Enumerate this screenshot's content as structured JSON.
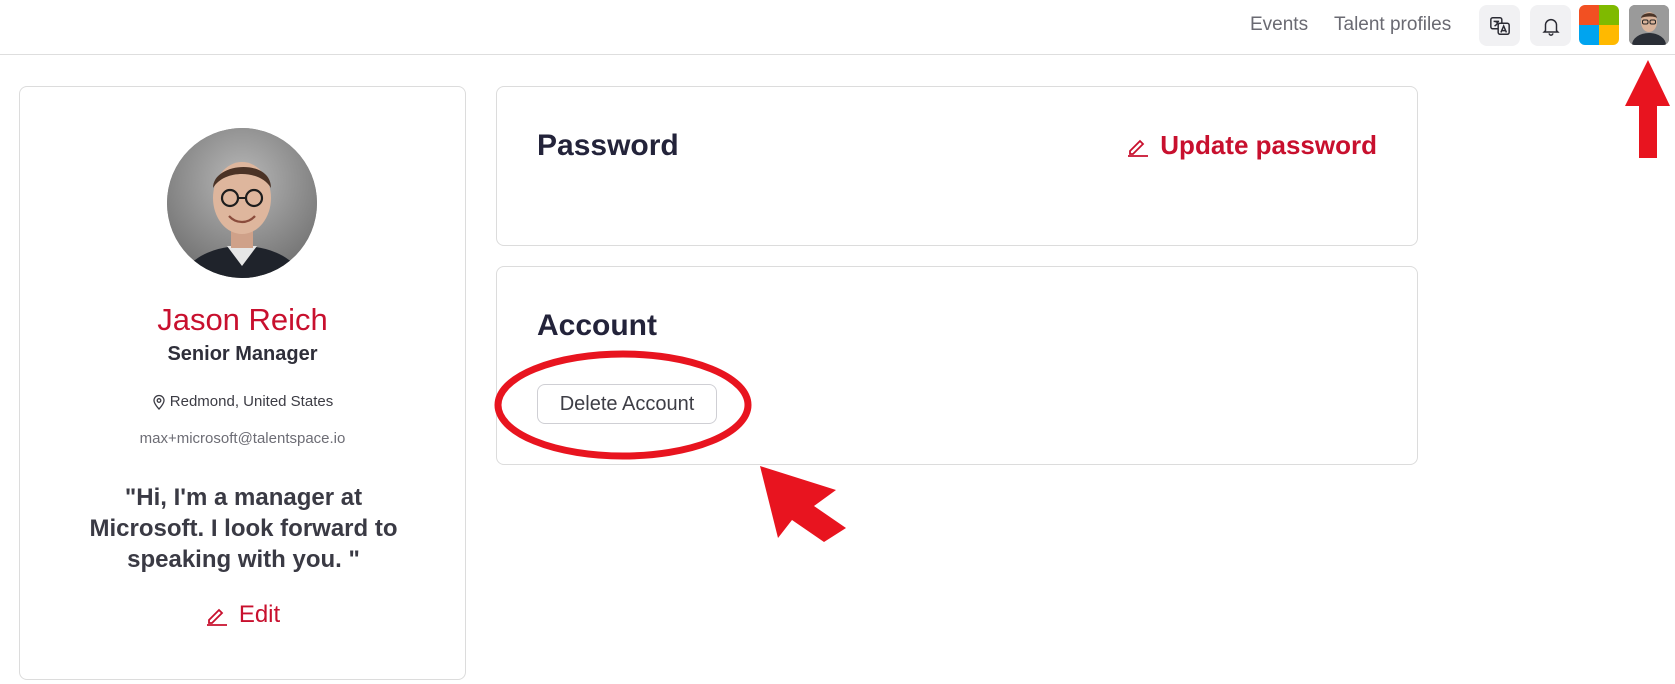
{
  "header": {
    "nav": [
      {
        "label": "Events"
      },
      {
        "label": "Talent profiles"
      }
    ],
    "icons": {
      "translate": "translate-icon",
      "notifications": "bell-icon",
      "org_logo": "microsoft-logo",
      "avatar": "user-avatar"
    }
  },
  "profile": {
    "name": "Jason Reich",
    "role": "Senior Manager",
    "location": "Redmond, United States",
    "email": "max+microsoft@talentspace.io",
    "quote": "\"Hi, I'm a manager at Microsoft. I look forward to speaking with you. \"",
    "edit_label": "Edit"
  },
  "password_card": {
    "title": "Password",
    "action_label": "Update password"
  },
  "account_card": {
    "title": "Account",
    "delete_label": "Delete Account"
  },
  "colors": {
    "accent": "#c8102e",
    "annotation": "#e8141f",
    "border": "#dcdcdc"
  }
}
